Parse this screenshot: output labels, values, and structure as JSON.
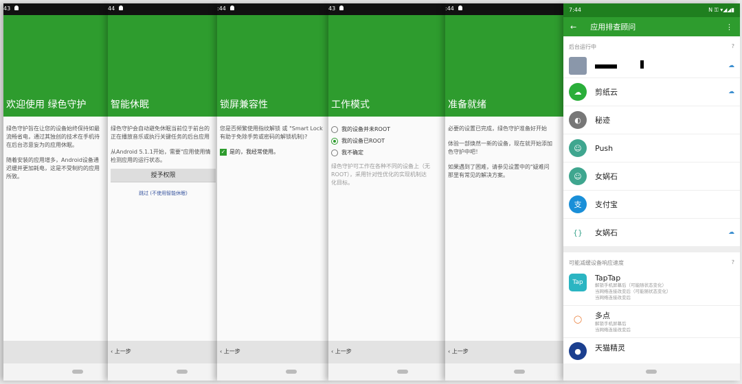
{
  "panels": [
    {
      "time": "43",
      "title": "欢迎使用 绿色守护",
      "p1": "绿色守护旨在让您的设备始终保持如最",
      "p2": "流畅省电，通过其独创的技术在手机待",
      "p3": "在后台恣意妄为的应用休眠。",
      "p4": "随着安装的应用增多，Android设备通",
      "p5": "迟缓并更加耗电，这是不受制约的应用",
      "p6": "所致。"
    },
    {
      "time": "44",
      "title": "智能休眠",
      "p1": "绿色守护会自动避免休眠当前位于前台的",
      "p2": "正在播放音乐或执行关键任务的后台应用",
      "p3": "从Android 5.1.1开始，需要\"应用使用情",
      "p4": "检测应用的运行状态。",
      "grant": "授予权限",
      "skip": "跳过 (不使用智能休眠)",
      "back": "上一步"
    },
    {
      "time": ":44",
      "title": "锁屏兼容性",
      "p1": "您是否频繁使用指纹解锁 或 \"Smart Lock",
      "p2": "有助于免除手势或密码的解锁机制)?",
      "check": "是的，我经常使用。",
      "back": "上一步"
    },
    {
      "time": "43",
      "title": "工作模式",
      "options": [
        "我的设备并未ROOT",
        "我的设备已ROOT",
        "我不确定"
      ],
      "p1": "绿色守护可工作在各种不同的设备上（无",
      "p2": "ROOT），采用针对性优化的实现机制达",
      "p3": "化目标。",
      "back": "上一步"
    },
    {
      "time": ":44",
      "title": "准备就绪",
      "p1": "必要的设置已完成，绿色守护准备好开始",
      "p2": "体验一部焕然一新的设备，现在就开始添加",
      "p3": "色守护中吧！",
      "p4": "如果遇到了困难，请参见设置中的\"疑难问",
      "p5": "那里有常见的解决方案。",
      "back": "上一步"
    }
  ],
  "advisor": {
    "time": "7:44",
    "title": "应用排查顾问",
    "section1": "后台运行中",
    "section2": "可能减缓设备响应速度",
    "apps": [
      {
        "name": "剪纸云",
        "color": "#2aae3a",
        "glyph": "☁"
      },
      {
        "name": "秘迹",
        "color": "#777",
        "glyph": "◐"
      },
      {
        "name": "Push",
        "color": "#3fa68f",
        "glyph": "☺"
      },
      {
        "name": "女娲石",
        "color": "#3fa68f",
        "glyph": "☺"
      },
      {
        "name": "支付宝",
        "color": "#1a8fd8",
        "glyph": "支"
      },
      {
        "name": "女娲石",
        "color": "#fff",
        "glyph": "{}"
      }
    ],
    "slow": [
      {
        "name": "TapTap",
        "glyph": "Tap",
        "subs": [
          "解锁手机屏幕后（可能随状态变化）",
          "当网络连接改变后（可能随状态变化）",
          "当网络连接改变后"
        ]
      },
      {
        "name": "多点",
        "glyph": "◯",
        "subs": [
          "解锁手机屏幕后",
          "当网络连接改变后"
        ]
      },
      {
        "name": "天猫精灵",
        "glyph": "●",
        "subs": []
      }
    ]
  }
}
